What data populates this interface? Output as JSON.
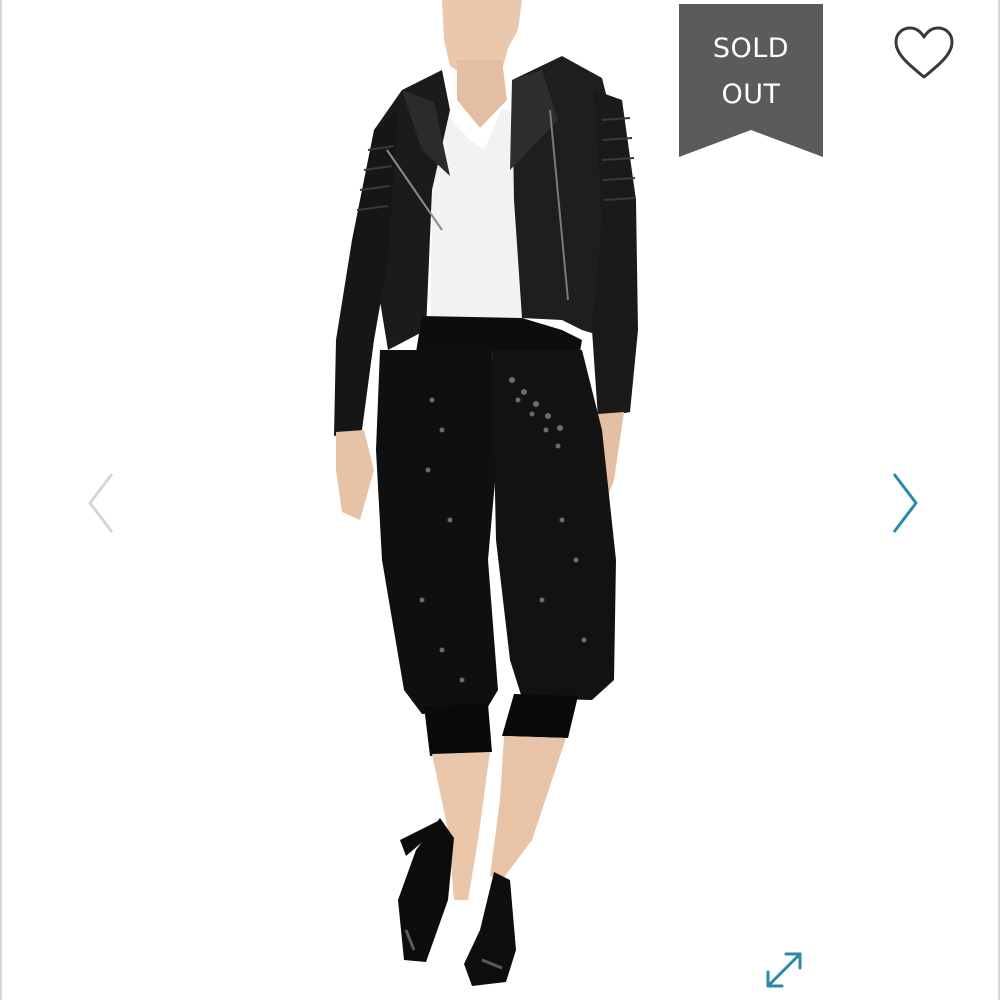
{
  "badge": {
    "line1": "SOLD",
    "line2": "OUT",
    "color": "#5b5b5b"
  },
  "icons": {
    "like": "heart-outline-icon",
    "previous": "chevron-left-icon",
    "next": "chevron-right-icon",
    "expand": "expand-diagonal-icon"
  },
  "colors": {
    "accent": "#2a8aa8",
    "nav_inactive": "#d6d6d6",
    "heart": "#3a3a3a"
  }
}
